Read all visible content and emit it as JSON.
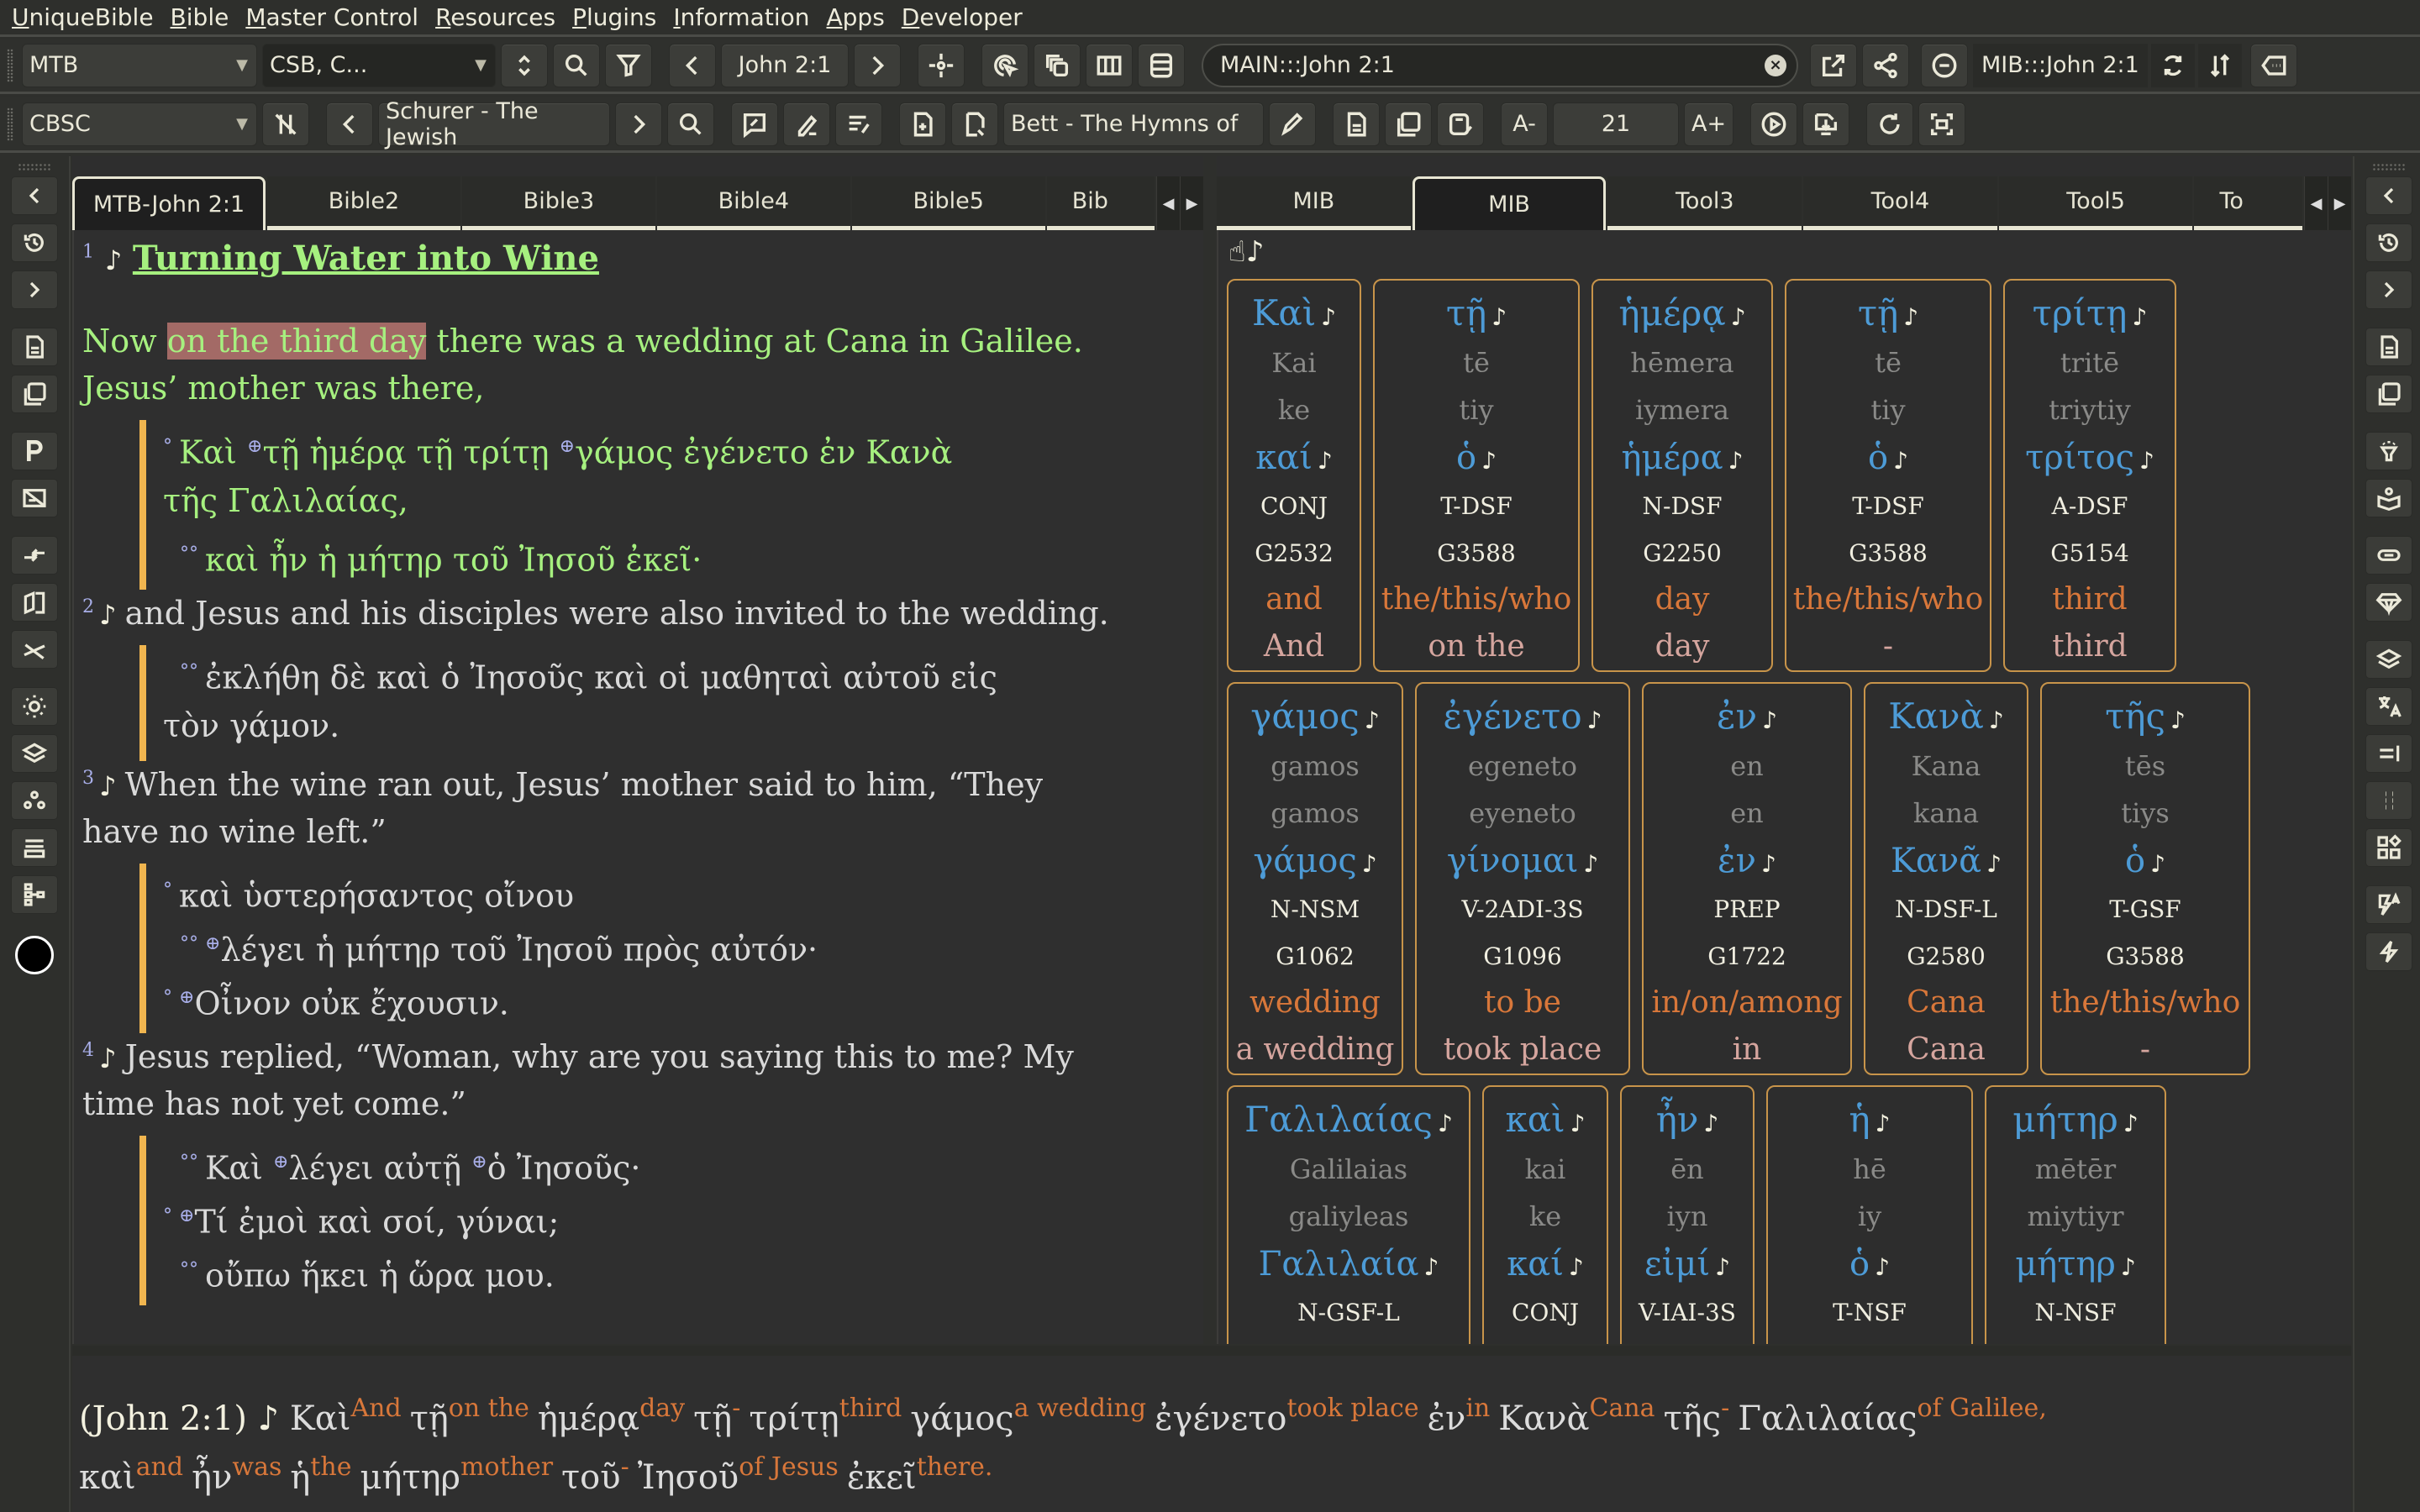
{
  "menu": [
    {
      "label": "UniqueBible",
      "u": "U",
      "rest": "niqueBible"
    },
    {
      "label": "Bible",
      "u": "B",
      "rest": "ible"
    },
    {
      "label": "Master Control",
      "u": "M",
      "rest": "aster Control"
    },
    {
      "label": "Resources",
      "u": "R",
      "rest": "esources"
    },
    {
      "label": "Plugins",
      "u": "P",
      "rest": "lugins"
    },
    {
      "label": "Information",
      "u": "I",
      "rest": "nformation"
    },
    {
      "label": "Apps",
      "u": "A",
      "rest": "pps"
    },
    {
      "label": "Developer",
      "u": "D",
      "rest": "eveloper"
    }
  ],
  "toolbar1": {
    "bible_select": "MTB",
    "compare_select": "CSB, C...",
    "reference": "John 2:1",
    "command_field": "MAIN:::John 2:1",
    "study_reference": "MIB:::John 2:1",
    "icons": {
      "swap": "up-down-arrows-icon",
      "search": "search-icon",
      "filter": "filter-icon",
      "prev": "chevron-left-icon",
      "next": "chevron-right-icon",
      "sync": "crosshair-icon",
      "pointer": "click-target-icon",
      "copy": "copy-windows-icon",
      "columns": "columns-icon",
      "rows": "rows-icon",
      "clear": "clear-icon",
      "open_external": "open-external-icon",
      "share": "share-icon",
      "minus": "minus-circle-icon",
      "refresh": "refresh-icon",
      "sort": "sort-arrows-icon",
      "more": "more-tag-icon"
    }
  },
  "toolbar2": {
    "commentary_select": "CBSC",
    "book_title": "Schurer - The Jewish",
    "hymn_title": "Bett - The Hymns of",
    "font_size": "21",
    "font_minus": "A-",
    "font_plus": "A+"
  },
  "left_panel": {
    "tabs": [
      "MTB-John 2:1",
      "Bible2",
      "Bible3",
      "Bible4",
      "Bible5",
      "Bib"
    ],
    "active_tab": 0,
    "heading": {
      "verse": "1",
      "title": "Turning Water into Wine"
    },
    "verses": [
      {
        "num": "1",
        "english_lines": [
          {
            "pre": "Now ",
            "highlight": "on the third day",
            "post": " there was a wedding at Cana in Galilee."
          },
          {
            "pre": "Jesus’ mother was there,",
            "highlight": "",
            "post": ""
          }
        ],
        "greek": [
          {
            "mark": "°",
            "text": "Καὶ ⊕τῇ ἡμέρᾳ τῇ τρίτῃ ⊕γάμος ἐγένετο ἐν Κανὰ"
          },
          {
            "mark": "",
            "text": "τῆς Γαλιλαίας,"
          },
          {
            "mark": "°°",
            "text": "καὶ ἦν ἡ μήτηρ τοῦ Ἰησοῦ ἐκεῖ·"
          }
        ]
      },
      {
        "num": "2",
        "english_lines": [
          {
            "pre": "and Jesus and his disciples were also invited to the wedding.",
            "highlight": "",
            "post": ""
          }
        ],
        "greek": [
          {
            "mark": "°°",
            "text": "ἐκλήθη δὲ καὶ ὁ Ἰησοῦς καὶ οἱ μαθηταὶ αὐτοῦ εἰς"
          },
          {
            "mark": "",
            "text": "τὸν γάμον."
          }
        ]
      },
      {
        "num": "3",
        "english_lines": [
          {
            "pre": "When the wine ran out, Jesus’ mother said to him, “They",
            "highlight": "",
            "post": ""
          },
          {
            "pre": "have no wine left.”",
            "highlight": "",
            "post": ""
          }
        ],
        "greek": [
          {
            "mark": "°",
            "text": "καὶ ὑστερήσαντος οἴνου"
          },
          {
            "mark": "°°",
            "text": "⊕λέγει ἡ μήτηρ τοῦ Ἰησοῦ πρὸς αὐτόν·"
          },
          {
            "mark": "°",
            "text": "⊕Οἶνον οὐκ ἔχουσιν."
          }
        ]
      },
      {
        "num": "4",
        "english_lines": [
          {
            "pre": "Jesus replied, “Woman, why are you saying this to me? My",
            "highlight": "",
            "post": ""
          },
          {
            "pre": "time has not yet come.”",
            "highlight": "",
            "post": ""
          }
        ],
        "greek": [
          {
            "mark": "°°",
            "text": "Καὶ ⊕λέγει αὐτῇ ⊕ὁ Ἰησοῦς·"
          },
          {
            "mark": "°",
            "text": "⊕Τί ἐμοὶ καὶ σοί, γύναι;"
          },
          {
            "mark": "°°",
            "text": "οὔπω ἥκει ἡ ὥρα μου."
          }
        ]
      }
    ]
  },
  "right_panel": {
    "tabs": [
      "MIB",
      "MIB",
      "Tool3",
      "Tool4",
      "Tool5",
      "To"
    ],
    "active_tab": 1,
    "words": [
      {
        "greek": "Καὶ",
        "translit": "Kai",
        "pron": "ke",
        "lexeme": "καί",
        "morph": "CONJ",
        "strongs": "G2532",
        "gloss": "and",
        "translation": "And"
      },
      {
        "greek": "τῇ",
        "translit": "tē",
        "pron": "tiy",
        "lexeme": "ὁ",
        "morph": "T-DSF",
        "strongs": "G3588",
        "gloss": "the/this/who",
        "translation": "on the"
      },
      {
        "greek": "ἡμέρᾳ",
        "translit": "hēmera",
        "pron": "iymera",
        "lexeme": "ἡμέρα",
        "morph": "N-DSF",
        "strongs": "G2250",
        "gloss": "day",
        "translation": "day"
      },
      {
        "greek": "τῇ",
        "translit": "tē",
        "pron": "tiy",
        "lexeme": "ὁ",
        "morph": "T-DSF",
        "strongs": "G3588",
        "gloss": "the/this/who",
        "translation": "-"
      },
      {
        "greek": "τρίτῃ",
        "translit": "tritē",
        "pron": "triytiy",
        "lexeme": "τρίτος",
        "morph": "A-DSF",
        "strongs": "G5154",
        "gloss": "third",
        "translation": "third"
      },
      {
        "greek": "γάμος",
        "translit": "gamos",
        "pron": "gamos",
        "lexeme": "γάμος",
        "morph": "N-NSM",
        "strongs": "G1062",
        "gloss": "wedding",
        "translation": "a wedding"
      },
      {
        "greek": "ἐγένετο",
        "translit": "egeneto",
        "pron": "eyeneto",
        "lexeme": "γίνομαι",
        "morph": "V-2ADI-3S",
        "strongs": "G1096",
        "gloss": "to be",
        "translation": "took place"
      },
      {
        "greek": "ἐν",
        "translit": "en",
        "pron": "en",
        "lexeme": "ἐν",
        "morph": "PREP",
        "strongs": "G1722",
        "gloss": "in/on/among",
        "translation": "in"
      },
      {
        "greek": "Κανὰ",
        "translit": "Kana",
        "pron": "kana",
        "lexeme": "Κανᾶ",
        "morph": "N-DSF-L",
        "strongs": "G2580",
        "gloss": "Cana",
        "translation": "Cana"
      },
      {
        "greek": "τῆς",
        "translit": "tēs",
        "pron": "tiys",
        "lexeme": "ὁ",
        "morph": "T-GSF",
        "strongs": "G3588",
        "gloss": "the/this/who",
        "translation": "-"
      },
      {
        "greek": "Γαλιλαίας",
        "translit": "Galilaias",
        "pron": "galiyleas",
        "lexeme": "Γαλιλαία",
        "morph": "N-GSF-L",
        "strongs": "",
        "gloss": "",
        "translation": ""
      },
      {
        "greek": "καὶ",
        "translit": "kai",
        "pron": "ke",
        "lexeme": "καί",
        "morph": "CONJ",
        "strongs": "",
        "gloss": "",
        "translation": ""
      },
      {
        "greek": "ἦν",
        "translit": "ēn",
        "pron": "iyn",
        "lexeme": "εἰμί",
        "morph": "V-IAI-3S",
        "strongs": "",
        "gloss": "",
        "translation": ""
      },
      {
        "greek": "ἡ",
        "translit": "hē",
        "pron": "iy",
        "lexeme": "ὁ",
        "morph": "T-NSF",
        "strongs": "",
        "gloss": "",
        "translation": ""
      },
      {
        "greek": "μήτηρ",
        "translit": "mētēr",
        "pron": "miytiyr",
        "lexeme": "μήτηρ",
        "morph": "N-NSF",
        "strongs": "",
        "gloss": "",
        "translation": ""
      }
    ]
  },
  "interlinear": {
    "reference": "(John 2:1)",
    "lines": [
      [
        {
          "g": "Καὶ",
          "e": "And"
        },
        {
          "g": "τῇ",
          "e": "on the"
        },
        {
          "g": "ἡμέρᾳ",
          "e": "day"
        },
        {
          "g": "τῇ",
          "e": "-"
        },
        {
          "g": "τρίτῃ",
          "e": "third"
        },
        {
          "g": "γάμος",
          "e": "a wedding"
        },
        {
          "g": "ἐγένετο",
          "e": "took place"
        },
        {
          "g": "ἐν",
          "e": "in"
        },
        {
          "g": "Κανὰ",
          "e": "Cana"
        },
        {
          "g": "τῆς",
          "e": "-"
        },
        {
          "g": "Γαλιλαίας",
          "e": "of Galilee,"
        }
      ],
      [
        {
          "g": "καὶ",
          "e": "and"
        },
        {
          "g": "ἦν",
          "e": "was"
        },
        {
          "g": "ἡ",
          "e": "the"
        },
        {
          "g": "μήτηρ",
          "e": "mother"
        },
        {
          "g": "τοῦ",
          "e": "-"
        },
        {
          "g": "Ἰησοῦ",
          "e": "of Jesus"
        },
        {
          "g": "ἐκεῖ",
          "e": "there."
        }
      ]
    ]
  },
  "side_left_icons": [
    "chevron-left-icon",
    "history-icon",
    "chevron-right-icon",
    "document-icon",
    "pdf-icon",
    "parallel-p-icon",
    "no-image-icon",
    "compare-arrows-icon",
    "book-split-icon",
    "no-line-icon",
    "brightness-icon",
    "layers-icon",
    "nodes-icon",
    "list-icon",
    "tree-icon"
  ],
  "side_right_icons": [
    "chevron-left-icon",
    "history-icon",
    "chevron-right-icon",
    "document-icon",
    "pdf-icon",
    "lamp-icon",
    "reader-icon",
    "link-icon",
    "diamond-icon",
    "layers-icon",
    "translate-icon",
    "align-right-icon",
    "grid-dots-icon",
    "widgets-icon",
    "flash-a-icon",
    "flash-icon"
  ],
  "colors": {
    "greek_word": "#4d9bd6",
    "gloss": "#d8773a",
    "translation": "#d5a59e",
    "english_green": "#a6f07f",
    "highlight": "#a36a66",
    "card_border": "#c8944a",
    "greek_bar": "#f0b54f"
  }
}
